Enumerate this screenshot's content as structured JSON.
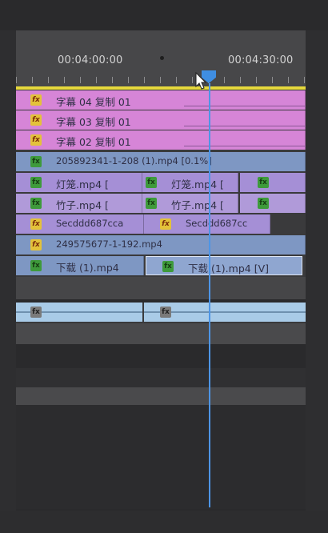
{
  "timecodes": {
    "left": "00:04:00:00",
    "right": "00:04:30:00"
  },
  "clips": {
    "c1": "字幕 04 复制 01",
    "c2": "字幕 03 复制 01",
    "c3": "字幕 02 复制 01",
    "c4": "205892341-1-208 (1).mp4 [0.1%]",
    "c5a": "灯笼.mp4 [",
    "c5b": "灯笼.mp4 [",
    "c6a": "竹子.mp4 [",
    "c6b": "竹子.mp4 [",
    "c7a": "Secddd687cca",
    "c7b": "Secddd687cc",
    "c8": "249575677-1-192.mp4",
    "c9a": "下载 (1).mp4",
    "c9b": "下载 (1).mp4 [V]"
  },
  "badges": {
    "fx": "fx",
    "fx_green": "fx"
  },
  "colors": {
    "title_clip": "#d685d7",
    "video_clip": "#7e97c3",
    "adjust_clip": "#a58fd6",
    "audio_clip": "#a9cbe7",
    "playhead": "#4d95e6",
    "work_area": "#e6d83c"
  },
  "icons": {
    "playhead": "playhead-marker-icon",
    "cursor": "mouse-pointer-icon"
  }
}
